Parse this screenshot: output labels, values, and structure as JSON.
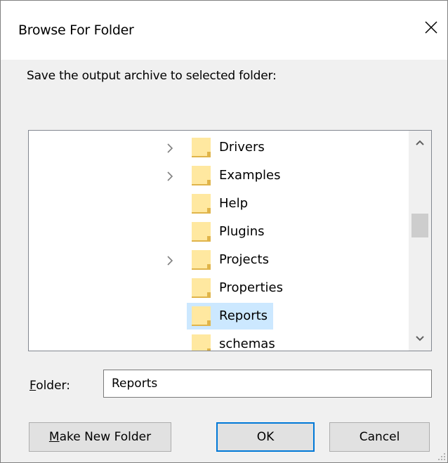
{
  "window": {
    "title": "Browse For Folder"
  },
  "instruction": "Save the output archive to selected folder:",
  "tree": {
    "items": [
      {
        "label": "Drivers",
        "expandable": true,
        "selected": false
      },
      {
        "label": "Examples",
        "expandable": true,
        "selected": false
      },
      {
        "label": "Help",
        "expandable": false,
        "selected": false
      },
      {
        "label": "Plugins",
        "expandable": false,
        "selected": false
      },
      {
        "label": "Projects",
        "expandable": true,
        "selected": false
      },
      {
        "label": "Properties",
        "expandable": false,
        "selected": false
      },
      {
        "label": "Reports",
        "expandable": false,
        "selected": true
      },
      {
        "label": "schemas",
        "expandable": false,
        "selected": false
      }
    ],
    "scroll_position": 0.5
  },
  "folder_field": {
    "label_accel": "F",
    "label_rest": "older:",
    "value": "Reports"
  },
  "buttons": {
    "make_new_folder_accel": "M",
    "make_new_folder_rest": "ake New Folder",
    "ok": "OK",
    "cancel": "Cancel"
  },
  "colors": {
    "selection": "#cce8ff",
    "folder_fill": "#ffe8a0",
    "folder_edge": "#e0b44a",
    "default_button_border": "#0078d7"
  },
  "icons": {
    "close": "close-icon",
    "folder": "folder-icon",
    "expand": "chevron-right-icon",
    "scroll_up": "chevron-up-icon",
    "scroll_down": "chevron-down-icon"
  }
}
